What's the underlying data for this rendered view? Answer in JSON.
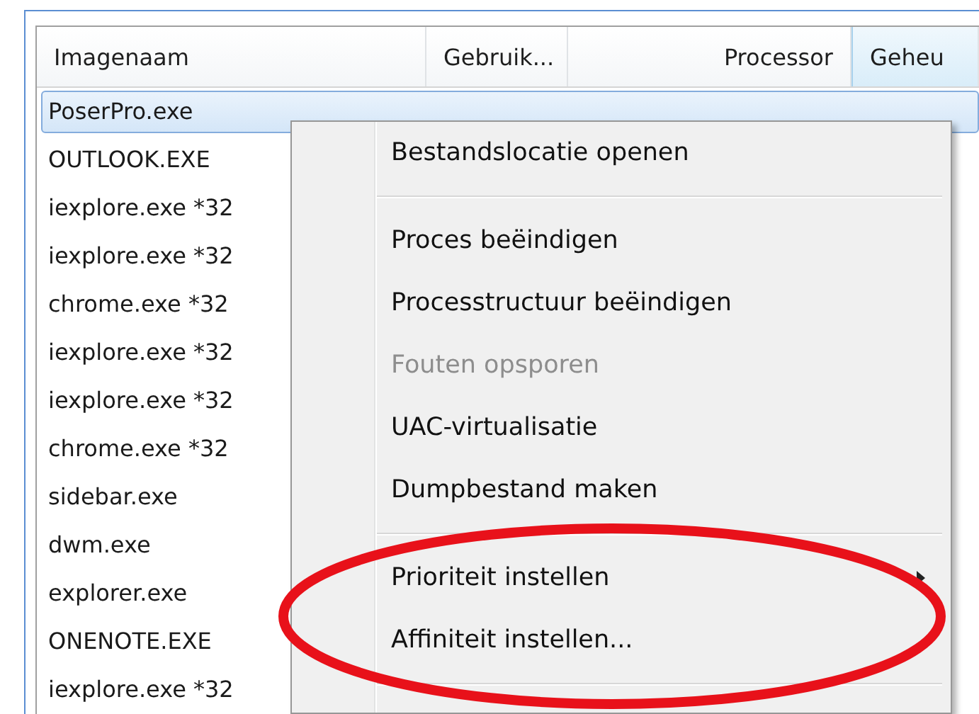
{
  "table": {
    "columns": [
      {
        "label": "Imagenaam",
        "hover": false
      },
      {
        "label": "Gebruik...",
        "hover": false
      },
      {
        "label": "Processor",
        "hover": false
      },
      {
        "label": "Geheu",
        "hover": true
      }
    ],
    "rows": [
      {
        "name": "PoserPro.exe",
        "selected": true
      },
      {
        "name": "OUTLOOK.EXE",
        "selected": false
      },
      {
        "name": "iexplore.exe *32",
        "selected": false
      },
      {
        "name": "iexplore.exe *32",
        "selected": false
      },
      {
        "name": "chrome.exe *32",
        "selected": false
      },
      {
        "name": "iexplore.exe *32",
        "selected": false
      },
      {
        "name": "iexplore.exe *32",
        "selected": false
      },
      {
        "name": "chrome.exe *32",
        "selected": false
      },
      {
        "name": "sidebar.exe",
        "selected": false
      },
      {
        "name": "dwm.exe",
        "selected": false
      },
      {
        "name": "explorer.exe",
        "selected": false
      },
      {
        "name": "ONENOTE.EXE",
        "selected": false
      },
      {
        "name": "iexplore.exe *32",
        "selected": false
      }
    ]
  },
  "context_menu": {
    "items": [
      {
        "kind": "item",
        "label": "Bestandslocatie openen",
        "disabled": false,
        "submenu": false
      },
      {
        "kind": "separator"
      },
      {
        "kind": "item",
        "label": "Proces beëindigen",
        "disabled": false,
        "submenu": false
      },
      {
        "kind": "item",
        "label": "Processtructuur beëindigen",
        "disabled": false,
        "submenu": false
      },
      {
        "kind": "item",
        "label": "Fouten opsporen",
        "disabled": true,
        "submenu": false
      },
      {
        "kind": "item",
        "label": "UAC-virtualisatie",
        "disabled": false,
        "submenu": false
      },
      {
        "kind": "item",
        "label": "Dumpbestand maken",
        "disabled": false,
        "submenu": false
      },
      {
        "kind": "separator"
      },
      {
        "kind": "item",
        "label": "Prioriteit instellen",
        "disabled": false,
        "submenu": true
      },
      {
        "kind": "item",
        "label": "Affiniteit instellen...",
        "disabled": false,
        "submenu": false
      },
      {
        "kind": "separator"
      }
    ]
  }
}
